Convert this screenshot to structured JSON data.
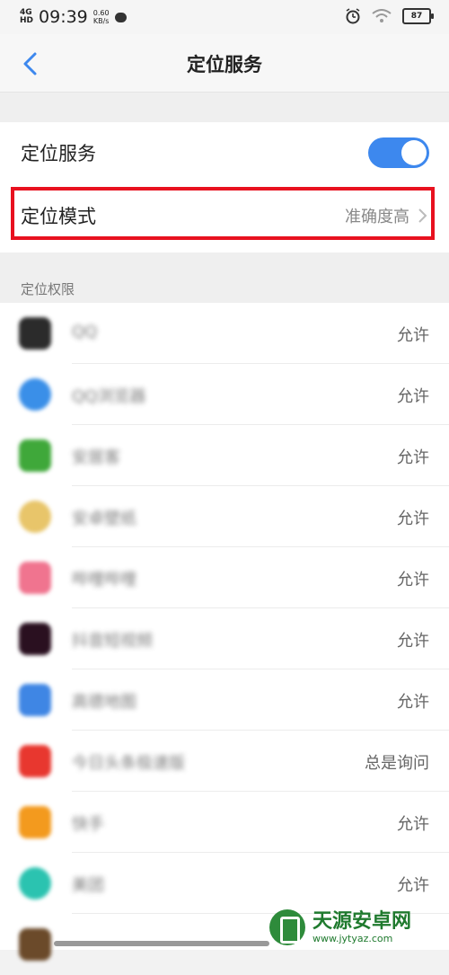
{
  "status_bar": {
    "network": "4G",
    "network_sub": "HD",
    "time": "09:39",
    "speed_value": "0.60",
    "speed_unit": "KB/s",
    "battery": "87"
  },
  "nav": {
    "title": "定位服务"
  },
  "settings": {
    "location_service_label": "定位服务",
    "location_service_enabled": true,
    "location_mode_label": "定位模式",
    "location_mode_value": "准确度高"
  },
  "permissions": {
    "header": "定位权限",
    "apps": [
      {
        "name": "QQ",
        "permission": "允许",
        "icon_color": "#2b2b2b"
      },
      {
        "name": "QQ浏览器",
        "permission": "允许",
        "icon_color": "#3a8fe8"
      },
      {
        "name": "安居客",
        "permission": "允许",
        "icon_color": "#3fa83a"
      },
      {
        "name": "安卓壁纸",
        "permission": "允许",
        "icon_color": "#e8c56a"
      },
      {
        "name": "哔哩哔哩",
        "permission": "允许",
        "icon_color": "#f0748f"
      },
      {
        "name": "抖音短视频",
        "permission": "允许",
        "icon_color": "#2a1020"
      },
      {
        "name": "高德地图",
        "permission": "允许",
        "icon_color": "#3f86e4"
      },
      {
        "name": "今日头条极速版",
        "permission": "总是询问",
        "icon_color": "#e8372f"
      },
      {
        "name": "快手",
        "permission": "允许",
        "icon_color": "#f39a1e"
      },
      {
        "name": "美团",
        "permission": "允许",
        "icon_color": "#2bc3b0"
      },
      {
        "name": "",
        "permission": "",
        "icon_color": "#6b4a2a"
      }
    ]
  },
  "watermark": {
    "name": "天源安卓网",
    "url": "www.jytyaz.com"
  },
  "colors": {
    "accent": "#3d88ee",
    "highlight": "#e8111f"
  }
}
